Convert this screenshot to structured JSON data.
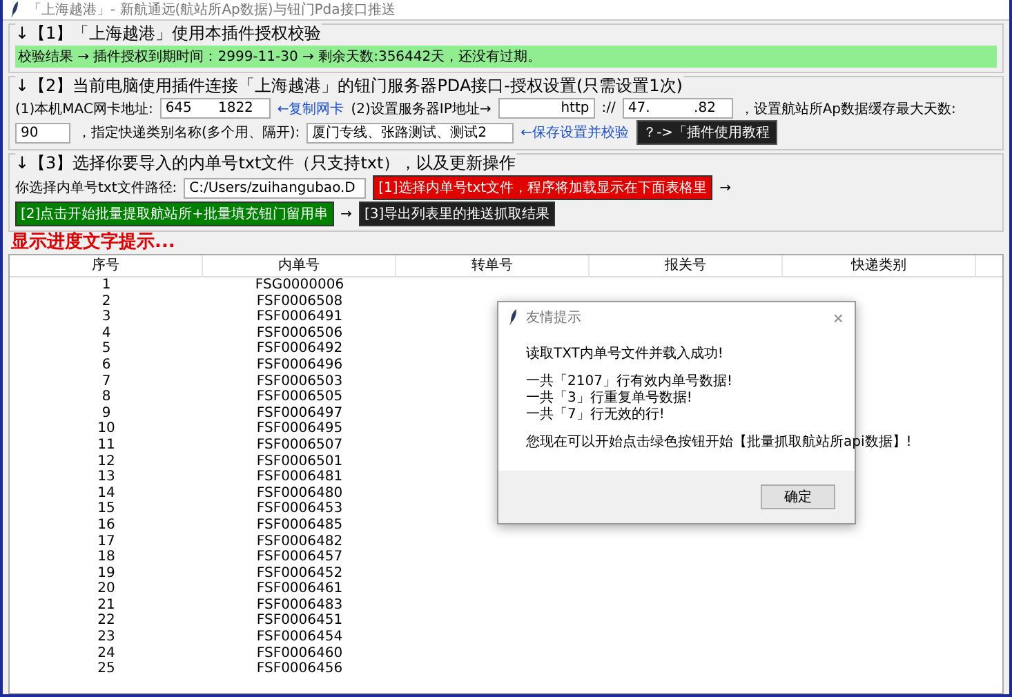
{
  "window": {
    "title": "「上海越港」- 新航通远(航站所Ap数据)与钮门Pda接口推送"
  },
  "section1": {
    "heading": "↓【1】「上海越港」使用本插件授权校验",
    "status": "校验结果 → 插件授权到期时间：2999-11-30 → 剩余天数:356442天，还没有过期。"
  },
  "section2": {
    "heading": "↓【2】当前电脑使用插件连接「上海越港」的钮门服务器PDA接口-授权设置(只需设置1次)",
    "mac_label": "(1)本机MAC网卡地址:",
    "mac_value": "645      1822",
    "copy_link": "←复制网卡",
    "ip_label": "(2)设置服务器IP地址→",
    "ip_scheme": "http",
    "ip_separator": "://",
    "ip_value": "47.          .82",
    "days_label": "，设置航站所Ap数据缓存最大天数:",
    "days_value": "90",
    "types_label": "，指定快递类别名称(多个用、隔开):",
    "types_value": "厦门专线、张路测试、测试2",
    "save_link": "←保存设置并校验",
    "tutorial_button": "？->「插件使用教程"
  },
  "section3": {
    "heading": "↓【3】选择你要导入的内单号txt文件（只支持txt），以及更新操作",
    "path_label": "你选择内单号txt文件路径:",
    "path_value": "C:/Users/zuihangubao.D",
    "buttons": [
      {
        "label": "[1]选择内单号txt文件，程序将加载显示在下面表格里",
        "color": "#e00000",
        "arrow": "→"
      },
      {
        "label": "[2]点击开始批量提取航站所+批量填充钮门留用串",
        "color": "#008000",
        "arrow": "→"
      },
      {
        "label": "[3]导出列表里的推送抓取结果",
        "color": "#202020"
      }
    ]
  },
  "progress": "显示进度文字提示...",
  "table": {
    "columns": [
      "序号",
      "内单号",
      "转单号",
      "报关号",
      "快递类别"
    ],
    "rows": [
      [
        "1",
        "FSG0000006"
      ],
      [
        "2",
        "FSF0006508"
      ],
      [
        "3",
        "FSF0006491"
      ],
      [
        "4",
        "FSF0006506"
      ],
      [
        "5",
        "FSF0006492"
      ],
      [
        "6",
        "FSF0006496"
      ],
      [
        "7",
        "FSF0006503"
      ],
      [
        "8",
        "FSF0006505"
      ],
      [
        "9",
        "FSF0006497"
      ],
      [
        "10",
        "FSF0006495"
      ],
      [
        "11",
        "FSF0006507"
      ],
      [
        "12",
        "FSF0006501"
      ],
      [
        "13",
        "FSF0006481"
      ],
      [
        "14",
        "FSF0006480"
      ],
      [
        "15",
        "FSF0006453"
      ],
      [
        "16",
        "FSF0006485"
      ],
      [
        "17",
        "FSF0006482"
      ],
      [
        "18",
        "FSF0006457"
      ],
      [
        "19",
        "FSF0006452"
      ],
      [
        "20",
        "FSF0006461"
      ],
      [
        "21",
        "FSF0006483"
      ],
      [
        "22",
        "FSF0006451"
      ],
      [
        "23",
        "FSF0006454"
      ],
      [
        "24",
        "FSF0006460"
      ],
      [
        "25",
        "FSF0006456"
      ]
    ]
  },
  "dialog": {
    "title": "友情提示",
    "close": "×",
    "paragraphs": [
      [
        "读取TXT内单号文件并载入成功!"
      ],
      [
        "一共「2107」行有效内单号数据!",
        "一共「3」行重复单号数据!",
        "一共「7」行无效的行!"
      ],
      [
        "您现在可以开始点击绿色按钮开始【批量抓取航站所api数据】!"
      ]
    ],
    "ok": "确定"
  }
}
